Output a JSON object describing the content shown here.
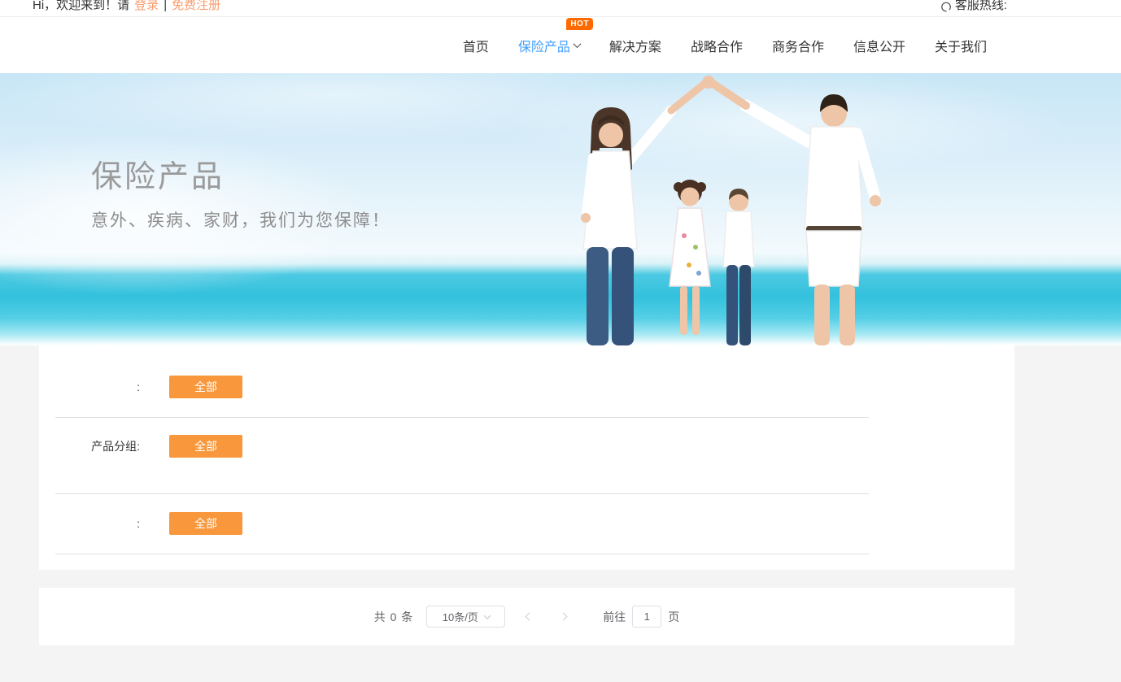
{
  "topbar": {
    "greeting": "Hi，欢迎来到！请",
    "login_link": "登录",
    "separator": "|",
    "register_link": "免费注册",
    "hotline_label": "客服热线:"
  },
  "nav": {
    "items": [
      {
        "label": "首页"
      },
      {
        "label": "保险产品",
        "badge": "HOT",
        "active": true
      },
      {
        "label": "解决方案"
      },
      {
        "label": "战略合作"
      },
      {
        "label": "商务合作"
      },
      {
        "label": "信息公开"
      },
      {
        "label": "关于我们"
      }
    ]
  },
  "banner": {
    "title": "保险产品",
    "subtitle": "意外、疾病、家财，我们为您保障！"
  },
  "filters": {
    "rows": [
      {
        "label": ":",
        "button_label": "全部"
      },
      {
        "label": "产品分组:",
        "button_label": "全部"
      },
      {
        "label": ":",
        "button_label": "全部"
      }
    ]
  },
  "pagination": {
    "total_text": "共 0 条",
    "page_size_value": "10条/页",
    "goto_label": "前往",
    "page_value": "1",
    "page_unit": "页"
  },
  "icons": {
    "hotline": "headset-icon",
    "nav_dropdown": "chevron-down-icon",
    "select": "chevron-down-icon",
    "prev": "chevron-left-icon",
    "next": "chevron-right-icon"
  },
  "colors": {
    "accent_orange": "#f8973b",
    "hot_badge": "#ff6a00",
    "active_nav": "#409eff",
    "topbar_link": "#fa9c6e",
    "page_background": "#f4f4f5"
  }
}
